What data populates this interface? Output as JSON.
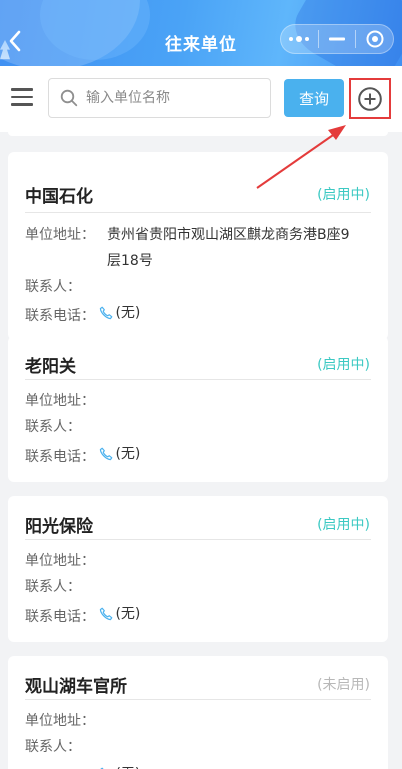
{
  "header": {
    "title": "往来单位",
    "back_icon": "chevron-left-icon",
    "more_icon": "more-dots-icon",
    "minimize_icon": "minimize-icon",
    "close_icon": "target-circle-icon"
  },
  "search": {
    "placeholder": "输入单位名称",
    "value": "",
    "query_label": "查询",
    "menu_icon": "menu-icon",
    "add_icon": "plus-circle-icon"
  },
  "labels": {
    "address": "单位地址：",
    "contact": "联系人：",
    "phone": "联系电话："
  },
  "colors": {
    "active_status": "#3cc9c3",
    "inactive_status": "#b8b8b8",
    "query_button": "#4ab1ee",
    "highlight": "#e43b3b"
  },
  "units": [
    {
      "name": "中国石化",
      "status": "(启用中)",
      "address_line1": "贵州省贵阳市观山湖区麒龙商务港B座9",
      "address_line2": "层18号",
      "contact": "",
      "phone": "(无)"
    },
    {
      "name": "老阳关",
      "status": "(启用中)",
      "address_line1": "",
      "address_line2": "",
      "contact": "",
      "phone": "(无)"
    },
    {
      "name": "阳光保险",
      "status": "(启用中)",
      "address_line1": "",
      "address_line2": "",
      "contact": "",
      "phone": "(无)"
    },
    {
      "name": "观山湖车官所",
      "status": "(未启用)",
      "address_line1": "",
      "address_line2": "",
      "contact": "",
      "phone": "(无)"
    }
  ]
}
